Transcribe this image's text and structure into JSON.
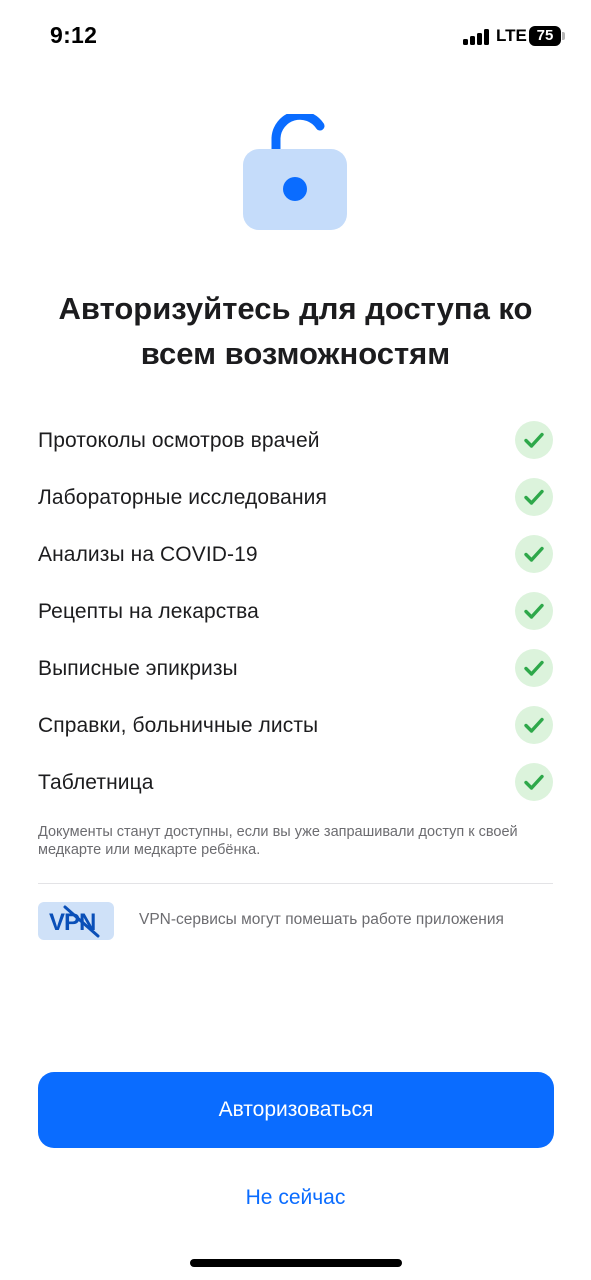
{
  "status_bar": {
    "time": "9:12",
    "network": "LTE",
    "battery": "75"
  },
  "lock": {
    "icon": "lock-open-icon",
    "accent_color": "#0a6cff",
    "body_color": "#c5dcfa"
  },
  "title": "Авторизуйтесь для доступа ко всем возможностям",
  "features": [
    {
      "label": "Протоколы осмотров врачей",
      "icon": "check-icon"
    },
    {
      "label": "Лабораторные исследования",
      "icon": "check-icon"
    },
    {
      "label": "Анализы на COVID-19",
      "icon": "check-icon"
    },
    {
      "label": "Рецепты на лекарства",
      "icon": "check-icon"
    },
    {
      "label": "Выписные эпикризы",
      "icon": "check-icon"
    },
    {
      "label": "Справки, больничные листы",
      "icon": "check-icon"
    },
    {
      "label": "Таблетница",
      "icon": "check-icon"
    }
  ],
  "note": "Документы станут доступны, если вы уже запрашивали доступ к своей медкарте или медкарте ребёнка.",
  "vpn": {
    "badge": "VPN",
    "text": "VPN-сервисы могут помешать работе приложения"
  },
  "actions": {
    "primary": "Авторизоваться",
    "secondary": "Не сейчас"
  },
  "colors": {
    "primary": "#0a6cff",
    "check_bg": "#dcf3dc",
    "check": "#2ea84a"
  }
}
